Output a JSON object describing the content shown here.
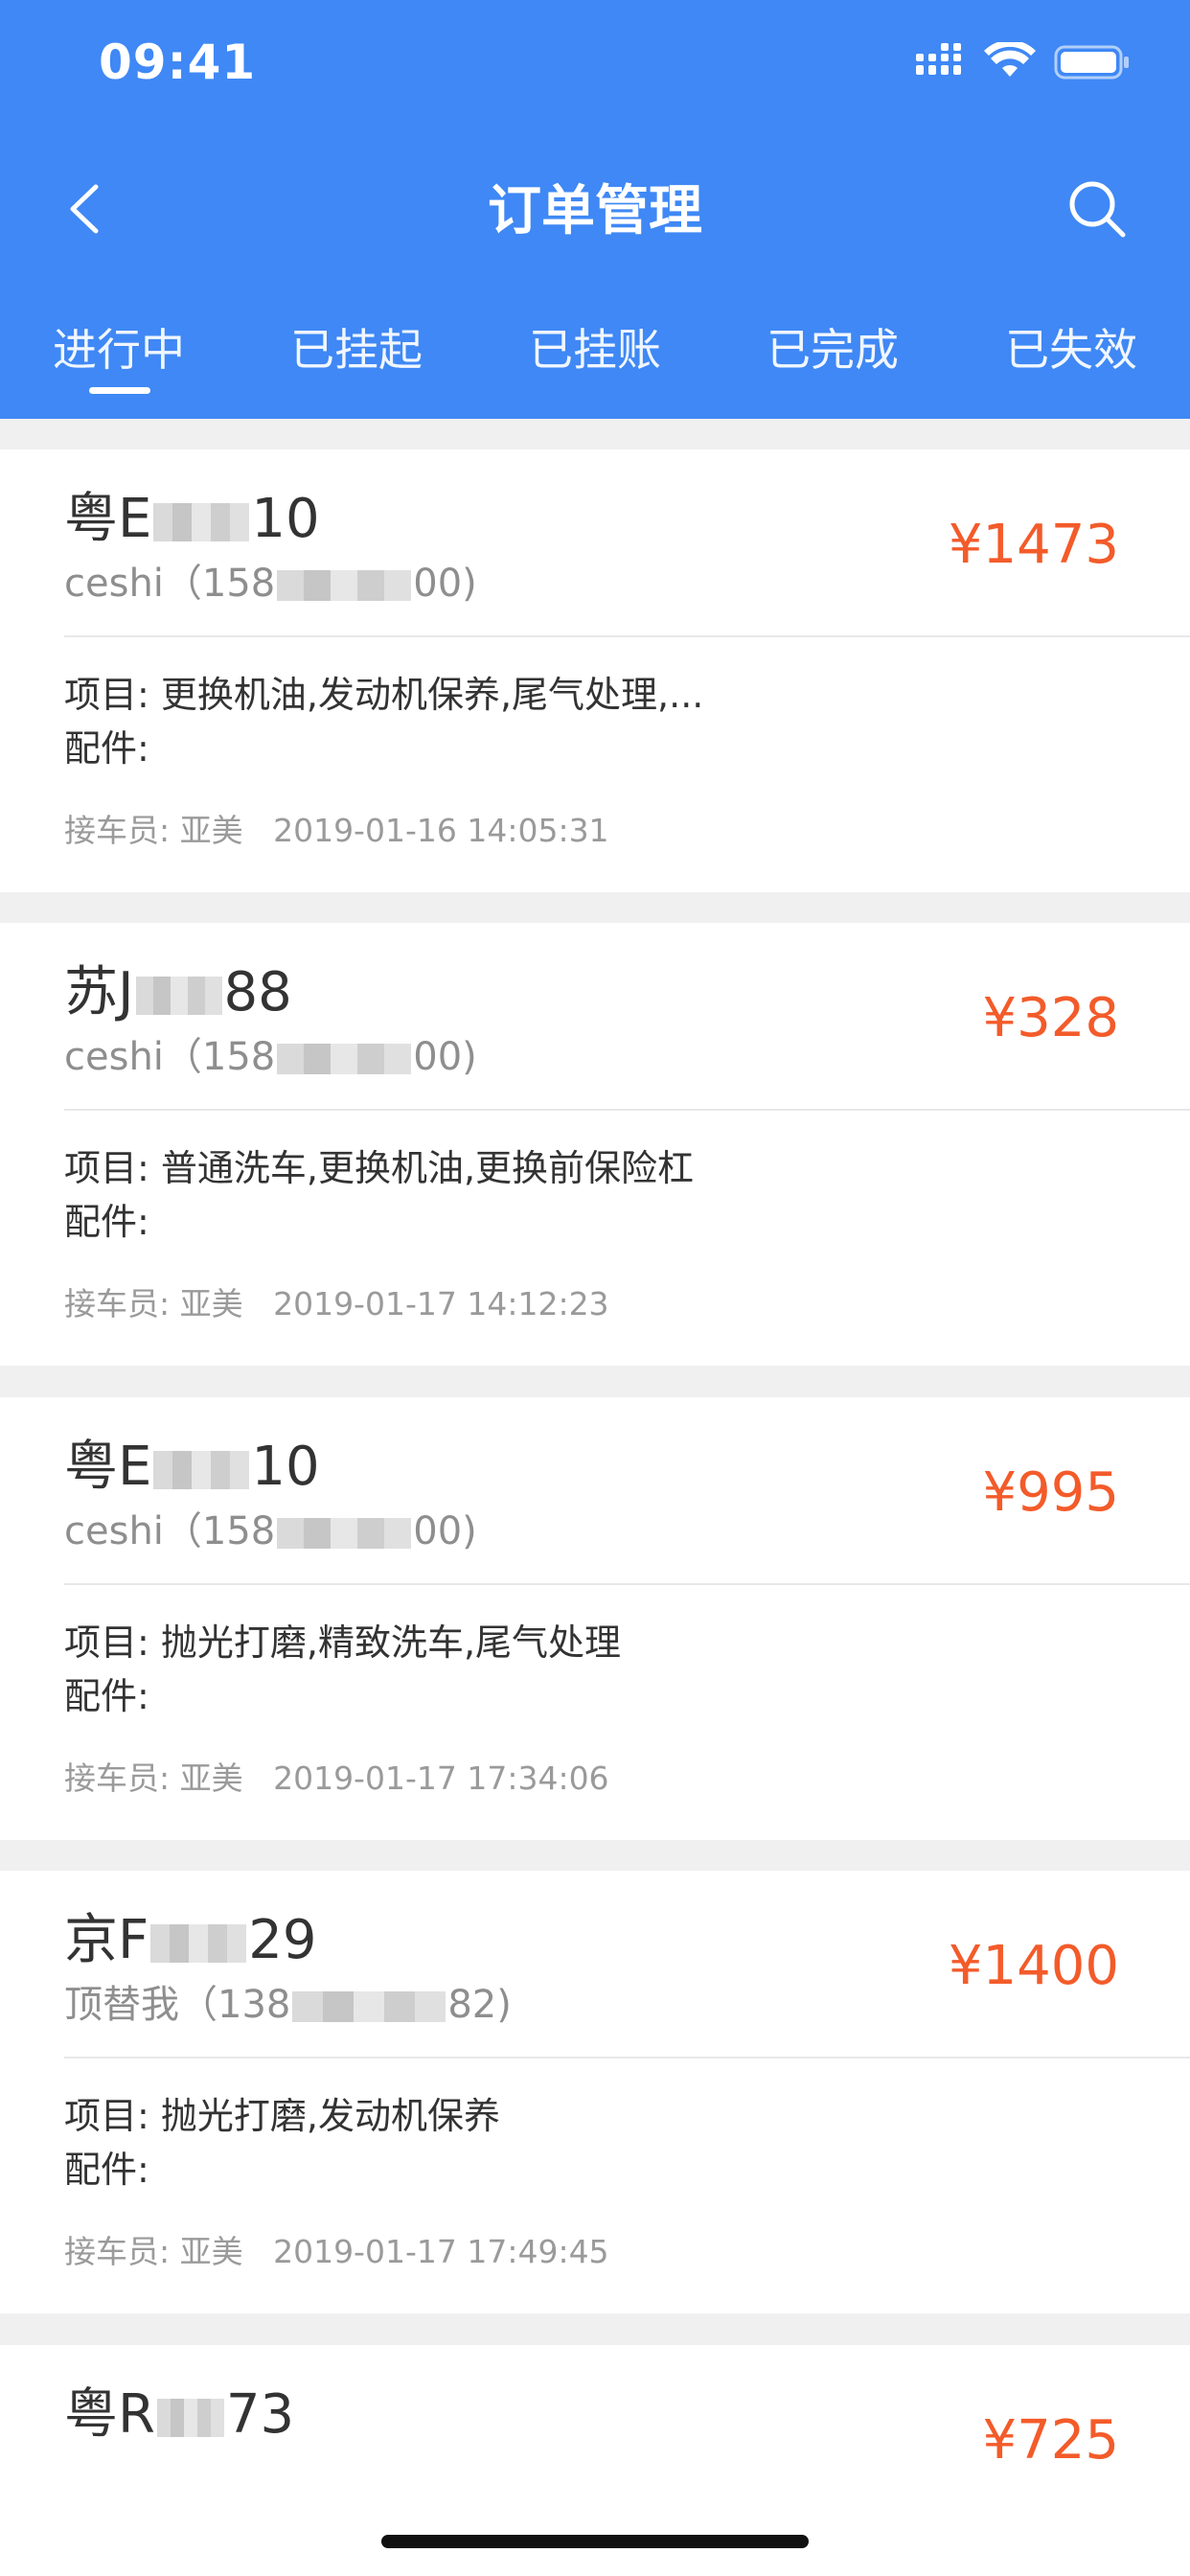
{
  "status_bar": {
    "time": "09:41"
  },
  "nav": {
    "title": "订单管理",
    "back_icon": "chevron-left-icon",
    "search_icon": "search-icon"
  },
  "tabs": [
    {
      "label": "进行中",
      "active": true
    },
    {
      "label": "已挂起",
      "active": false
    },
    {
      "label": "已挂账",
      "active": false
    },
    {
      "label": "已完成",
      "active": false
    },
    {
      "label": "已失效",
      "active": false
    }
  ],
  "orders": [
    {
      "plate_prefix": "粤E",
      "plate_suffix": "10",
      "customer_prefix": "ceshi（158",
      "customer_suffix": "00)",
      "price": "¥1473",
      "items": "项目: 更换机油,发动机保养,尾气处理,...",
      "parts": "配件:",
      "meta": "接车员: 亚美   2019-01-16 14:05:31"
    },
    {
      "plate_prefix": "苏J",
      "plate_suffix": "88",
      "customer_prefix": "ceshi（158",
      "customer_suffix": "00)",
      "price": "¥328",
      "items": "项目: 普通洗车,更换机油,更换前保险杠",
      "parts": "配件:",
      "meta": "接车员: 亚美   2019-01-17 14:12:23"
    },
    {
      "plate_prefix": "粤E",
      "plate_suffix": "10",
      "customer_prefix": "ceshi（158",
      "customer_suffix": "00)",
      "price": "¥995",
      "items": "项目: 抛光打磨,精致洗车,尾气处理",
      "parts": "配件:",
      "meta": "接车员: 亚美   2019-01-17 17:34:06"
    },
    {
      "plate_prefix": "京F",
      "plate_suffix": "29",
      "customer_prefix": "顶替我（138",
      "customer_suffix": "82)",
      "price": "¥1400",
      "items": "项目: 抛光打磨,发动机保养",
      "parts": "配件:",
      "meta": "接车员: 亚美   2019-01-17 17:49:45"
    },
    {
      "plate_prefix": "粤R",
      "plate_suffix": "73",
      "customer_prefix": "",
      "customer_suffix": "",
      "price": "¥725",
      "items": "",
      "parts": "",
      "meta": ""
    }
  ],
  "colors": {
    "header_blue": "#3f88f5",
    "price_orange": "#f35b2a",
    "background": "#f0f0f0"
  }
}
